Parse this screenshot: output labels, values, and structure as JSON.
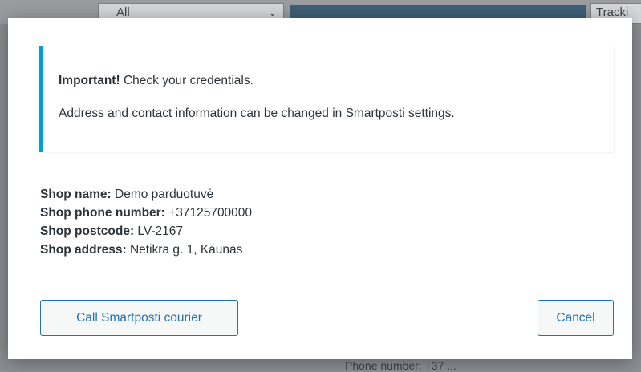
{
  "background": {
    "filter_select_value": "All",
    "tracking_label": "Tracki",
    "bottom_text": "Phone number: +37 ..."
  },
  "notice": {
    "important_label": "Important!",
    "important_text": " Check your credentials.",
    "address_text": "Address and contact information can be changed in Smartposti settings."
  },
  "shop": {
    "name_label": "Shop name:",
    "name_value": " Demo parduotuvė",
    "phone_label": "Shop phone number:",
    "phone_value": " +37125700000",
    "postcode_label": "Shop postcode:",
    "postcode_value": " LV-2167",
    "address_label": "Shop address:",
    "address_value": " Netikra g. 1, Kaunas"
  },
  "buttons": {
    "call_courier": "Call Smartposti courier",
    "cancel": "Cancel"
  },
  "colors": {
    "accent": "#2271b1",
    "notice_border": "#00a0d2",
    "overlay": "#8c8f94"
  }
}
